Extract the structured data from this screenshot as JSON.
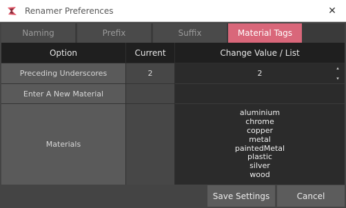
{
  "window": {
    "title": "Renamer Preferences",
    "close_symbol": "✕"
  },
  "tabs": [
    {
      "label": "Naming",
      "active": false
    },
    {
      "label": "Prefix",
      "active": false
    },
    {
      "label": "Suffix",
      "active": false
    },
    {
      "label": "Material Tags",
      "active": true
    }
  ],
  "table": {
    "headers": [
      "Option",
      "Current",
      "Change Value / List"
    ],
    "rows": [
      {
        "option": "Preceding Underscores",
        "current": "2",
        "value": "2"
      },
      {
        "option": "Enter A New Material",
        "current": "",
        "value": ""
      },
      {
        "option": "Materials",
        "current": ""
      }
    ],
    "materials": [
      "aluminium",
      "chrome",
      "copper",
      "metal",
      "paintedMetal",
      "plastic",
      "silver",
      "wood"
    ]
  },
  "buttons": {
    "save": "Save Settings",
    "cancel": "Cancel"
  },
  "icons": {
    "spin_up": "▴",
    "spin_down": "▾"
  },
  "colors": {
    "active_tab": "#d9677a",
    "background": "#444444"
  }
}
